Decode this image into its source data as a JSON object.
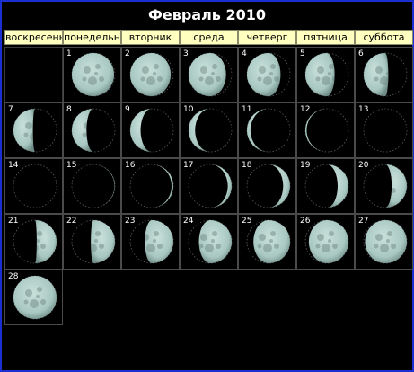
{
  "title": "Февраль 2010",
  "weekdays": [
    "воскресенье",
    "понедельник",
    "вторник",
    "среда",
    "четверг",
    "пятница",
    "суббота"
  ],
  "first_weekday_index": 1,
  "days": [
    {
      "day": "1",
      "illumination": 0.98,
      "side": "waning"
    },
    {
      "day": "2",
      "illumination": 0.94,
      "side": "waning"
    },
    {
      "day": "3",
      "illumination": 0.87,
      "side": "waning"
    },
    {
      "day": "4",
      "illumination": 0.78,
      "side": "waning"
    },
    {
      "day": "5",
      "illumination": 0.68,
      "side": "waning"
    },
    {
      "day": "6",
      "illumination": 0.57,
      "side": "waning"
    },
    {
      "day": "7",
      "illumination": 0.45,
      "side": "waning"
    },
    {
      "day": "8",
      "illumination": 0.34,
      "side": "waning"
    },
    {
      "day": "9",
      "illumination": 0.24,
      "side": "waning"
    },
    {
      "day": "10",
      "illumination": 0.15,
      "side": "waning"
    },
    {
      "day": "11",
      "illumination": 0.08,
      "side": "waning"
    },
    {
      "day": "12",
      "illumination": 0.03,
      "side": "waning"
    },
    {
      "day": "13",
      "illumination": 0.0,
      "side": "waning"
    },
    {
      "day": "14",
      "illumination": 0.0,
      "side": "waxing"
    },
    {
      "day": "15",
      "illumination": 0.01,
      "side": "waxing"
    },
    {
      "day": "16",
      "illumination": 0.04,
      "side": "waxing"
    },
    {
      "day": "17",
      "illumination": 0.09,
      "side": "waxing"
    },
    {
      "day": "18",
      "illumination": 0.16,
      "side": "waxing"
    },
    {
      "day": "19",
      "illumination": 0.25,
      "side": "waxing"
    },
    {
      "day": "20",
      "illumination": 0.35,
      "side": "waxing"
    },
    {
      "day": "21",
      "illumination": 0.46,
      "side": "waxing"
    },
    {
      "day": "22",
      "illumination": 0.56,
      "side": "waxing"
    },
    {
      "day": "23",
      "illumination": 0.66,
      "side": "waxing"
    },
    {
      "day": "24",
      "illumination": 0.76,
      "side": "waxing"
    },
    {
      "day": "25",
      "illumination": 0.85,
      "side": "waxing"
    },
    {
      "day": "26",
      "illumination": 0.92,
      "side": "waxing"
    },
    {
      "day": "27",
      "illumination": 0.97,
      "side": "waxing"
    },
    {
      "day": "28",
      "illumination": 1.0,
      "side": "waxing"
    }
  ],
  "colors": {
    "background": "#000000",
    "border": "#1a2fd0",
    "header_bg": "#ffffc0",
    "moon_lit": "#a9c8c2",
    "moon_dark_outline": "#5a5a5a"
  }
}
